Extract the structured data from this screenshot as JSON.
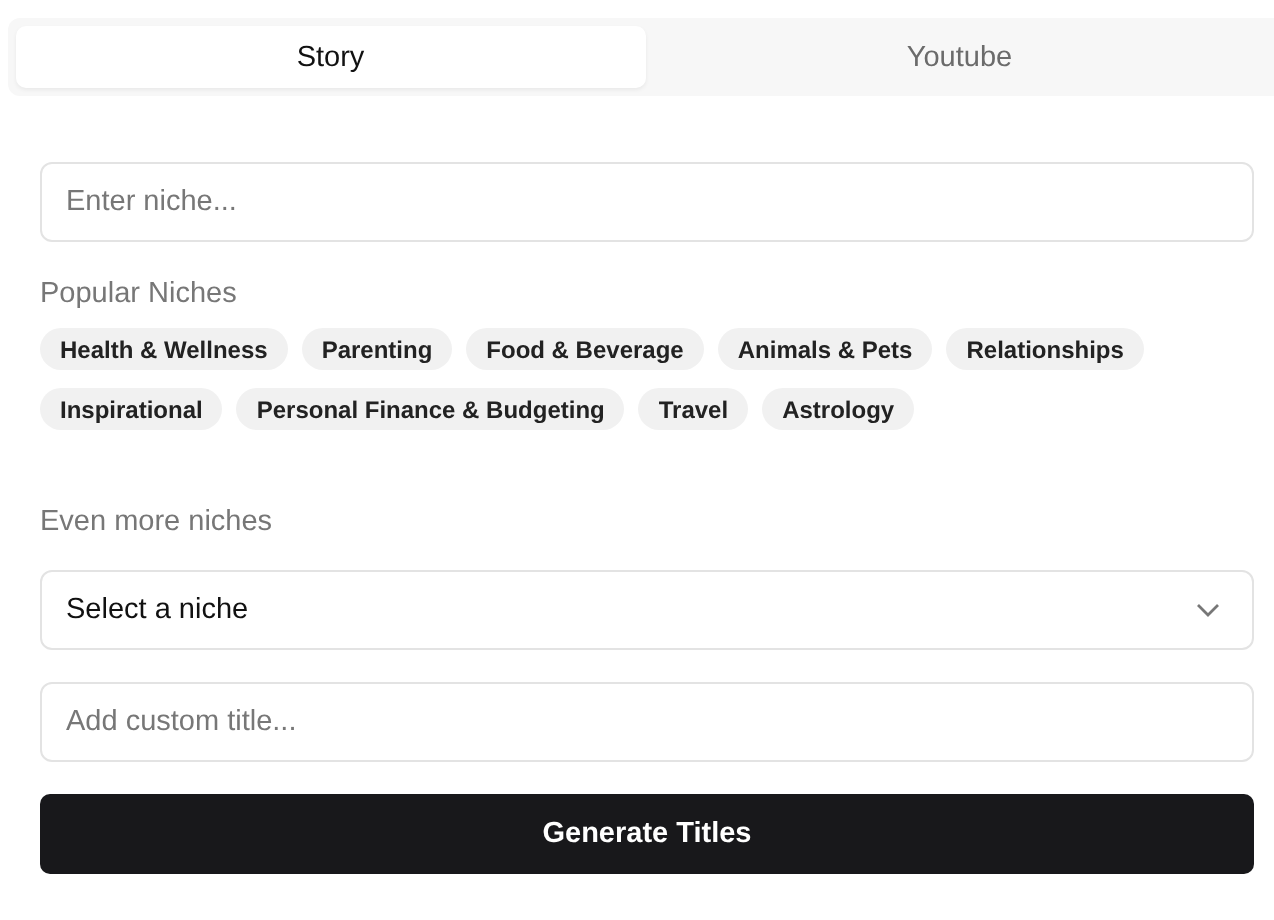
{
  "tabs": [
    {
      "label": "Story",
      "selected": true
    },
    {
      "label": "Youtube",
      "selected": false
    }
  ],
  "niche_input": {
    "placeholder": "Enter niche..."
  },
  "popular_niches": {
    "heading": "Popular Niches",
    "chips": [
      "Health & Wellness",
      "Parenting",
      "Food & Beverage",
      "Animals & Pets",
      "Relationships",
      "Inspirational",
      "Personal Finance & Budgeting",
      "Travel",
      "Astrology"
    ]
  },
  "more_niches": {
    "heading": "Even more niches",
    "select": {
      "value": "Select a niche"
    }
  },
  "custom_title": {
    "placeholder": "Add custom title..."
  },
  "generate_button": {
    "label": "Generate Titles"
  }
}
